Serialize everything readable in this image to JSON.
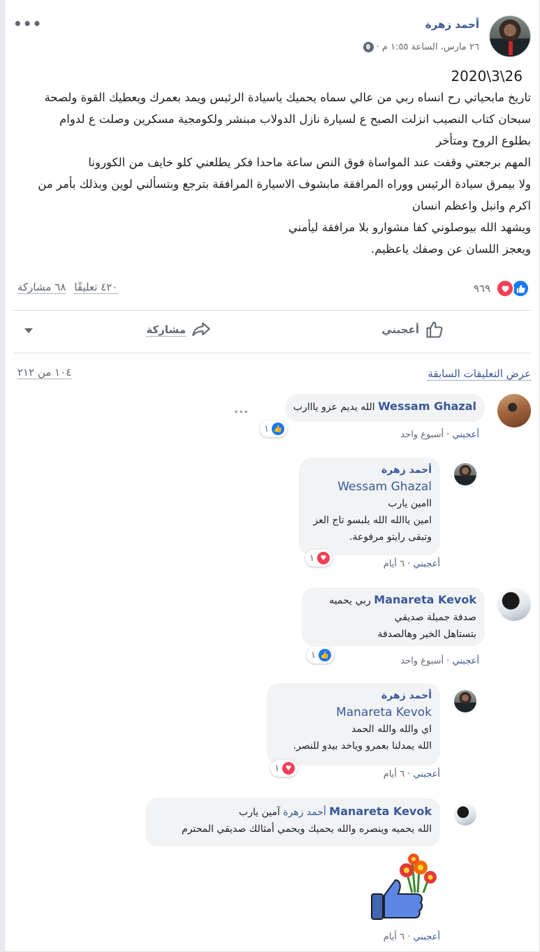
{
  "post": {
    "author": "أحمد زهرة",
    "meta": "٢٦ مارس، الساعة ١:٥٥ م ·",
    "date_line": "2020\\3\\26",
    "body_lines": [
      "تاريخ مابحياتي رح انساه ربي من عالي سماه يحميك ياسيادة الرئيس ويمد بعمرك ويعطيك القوة ولصحة",
      "سبحان كتاب النصيب انزلت الصبح ع لسيارة نازل الدولاب مبنشر ولكومجية مسكرين وصلت ع لدوام",
      "بطلوع الروح ومتأخر",
      "المهم برجعتي وقفت عند المواساة فوق النص ساعة ماحدا فكر يطلعني كلو خايف من الكورونا",
      "ولا بيمرق سيادة الرئيس ووراه المرافقة مابشوف الاسيارة المرافقة بترجع وبتسألني لوين وبذلك بأمر من",
      "اكرم وانبل واعظم انسان",
      "ويشهد الله بيوصلوني كفا مشوارو بلا مرافقة ليأمني",
      "ويعجز اللسان عن وصفك ياعظيم."
    ],
    "reaction_count": "٩٦٩",
    "comments_count": "٤٢٠ تعليقًا",
    "shares_count": "٦٨ مشاركة",
    "like_label": "أعجبني",
    "share_label": "مشاركة",
    "globe_icon": "globe-icon",
    "colors": {
      "link": "#385898",
      "like": "#1877f2",
      "love": "#f33e58"
    }
  },
  "comments": {
    "view_previous": "عرض التعليقات السابقة",
    "page_count": "١٠٤ من ٢١٢",
    "items": [
      {
        "name": "Wessam Ghazal",
        "text": "الله يديم عزو يااارب",
        "reaction": "١",
        "like": "أعجبني",
        "time": "أسبوع واحد"
      },
      {
        "name": "أحمد زهرة",
        "mention": "Wessam Ghazal",
        "lines": [
          "اامين يارب",
          "امين ياالله الله يلبسو تاج العز",
          "وتبقى رايتو مرفوعة."
        ],
        "reaction": "١",
        "like": "أعجبني",
        "time": "٦ أيام"
      },
      {
        "name": "Manareta Kevok",
        "lines": [
          "ربي يحميه",
          "صدفة جميلة صديقي",
          "بتستاهل الخير وهالصدفة"
        ],
        "reaction": "١",
        "like": "أعجبني",
        "time": "أسبوع واحد"
      },
      {
        "name": "أحمد زهرة",
        "mention": "Manareta Kevok",
        "lines": [
          "اي والله والله الحمد",
          "الله يمدلنا بعمرو وياخد بيدو للنصر."
        ],
        "reaction": "١",
        "like": "أعجبني",
        "time": "٦ أيام"
      },
      {
        "name": "Manareta Kevok",
        "mention": "أحمد زهرة",
        "lines": [
          "آمين يارب",
          "الله يحميه وينصره والله يحميك ويحمي أمثالك صديقي المحترم"
        ],
        "like": "أعجبني",
        "time": "٦ أيام"
      }
    ],
    "dot": "·"
  }
}
